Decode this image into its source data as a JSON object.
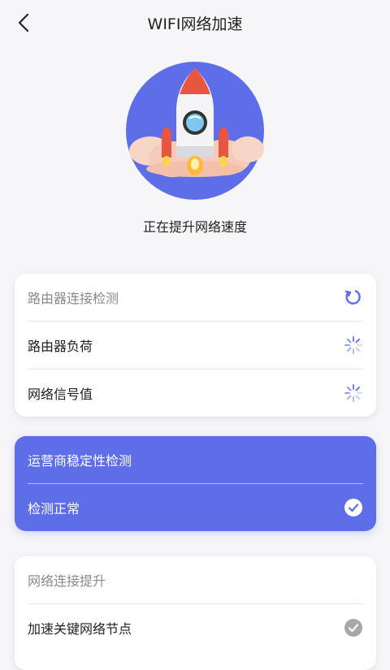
{
  "header": {
    "title": "WIFI网络加速",
    "back_icon": "chevron-left-icon"
  },
  "hero": {
    "status": "正在提升网络速度",
    "accent": "#5d6ee8"
  },
  "cards": [
    {
      "heading": "路由器连接检测",
      "heading_icon": "refresh-icon",
      "items": [
        {
          "label": "路由器负荷",
          "icon": "loading-spinner-icon"
        },
        {
          "label": "网络信号值",
          "icon": "loading-spinner-icon"
        }
      ]
    },
    {
      "heading": "运营商稳定性检测",
      "items": [
        {
          "label": "检测正常",
          "icon": "check-circle-icon"
        }
      ]
    },
    {
      "heading": "网络连接提升",
      "items": [
        {
          "label": "加速关键网络节点",
          "icon": "check-circle-grey-icon"
        }
      ]
    }
  ]
}
